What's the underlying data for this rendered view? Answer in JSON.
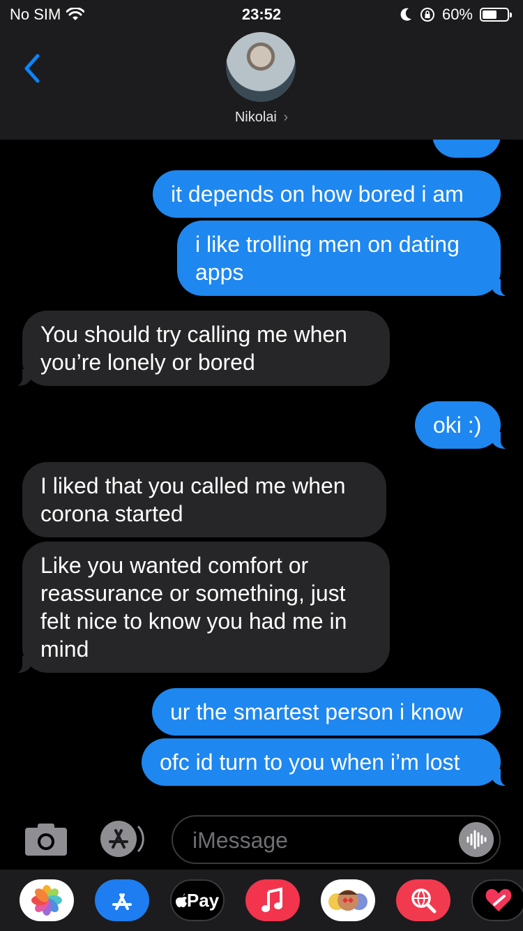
{
  "status_bar": {
    "carrier": "No SIM",
    "time": "23:52",
    "battery_percent": "60%",
    "battery_level": 0.6
  },
  "header": {
    "contact_name": "Nikolai",
    "chevron": "›"
  },
  "messages": [
    {
      "dir": "out",
      "text": "it depends on how bored i am"
    },
    {
      "dir": "out",
      "text": "i like trolling men on dating apps"
    },
    {
      "dir": "in",
      "text": "You should try calling me when you’re lonely or bored"
    },
    {
      "dir": "out",
      "text": "oki :)"
    },
    {
      "dir": "in",
      "text": "I liked that you called me when corona started"
    },
    {
      "dir": "in",
      "text": "Like you wanted comfort or reassurance or something, just felt nice to know you had me in mind"
    },
    {
      "dir": "out",
      "text": "ur the smartest person i know"
    },
    {
      "dir": "out",
      "text": "ofc id turn to you when i’m lost"
    }
  ],
  "input": {
    "placeholder": "iMessage"
  },
  "app_drawer": {
    "apple_pay_label": "Pay",
    "apps": [
      "photos-icon",
      "app-store-icon",
      "apple-pay-icon",
      "music-icon",
      "memoji-icon",
      "search-web-icon",
      "digital-touch-icon"
    ]
  },
  "colors": {
    "outgoing": "#1e87f0",
    "incoming": "#262628",
    "header_bg": "#1c1c1e",
    "accent": "#0a84ff"
  }
}
